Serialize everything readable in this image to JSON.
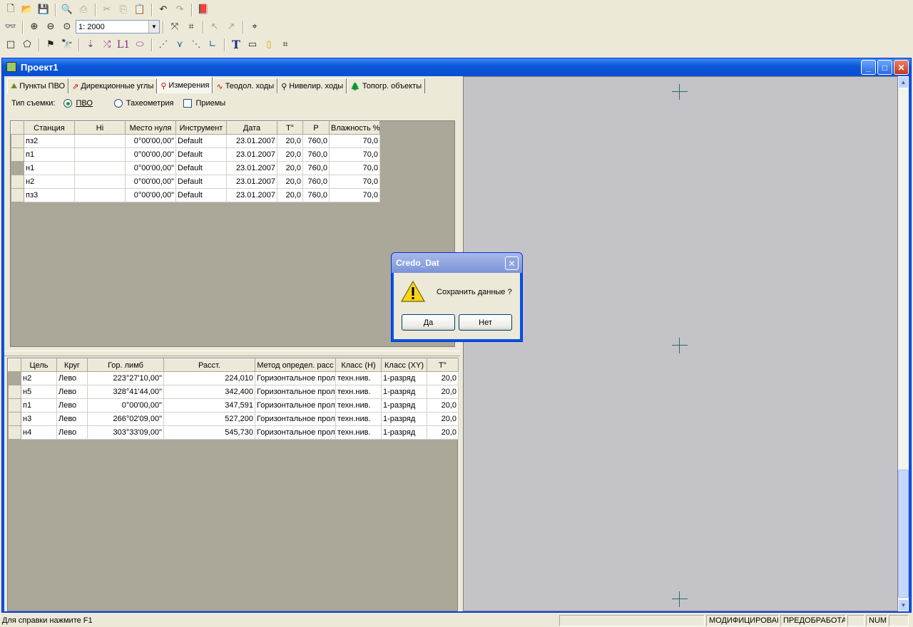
{
  "toolbar1": {
    "icons": [
      "new-file-icon",
      "open-folder-icon",
      "save-icon",
      "print-preview-icon",
      "print-icon",
      "cut-icon",
      "copy-icon",
      "paste-icon",
      "undo-icon",
      "redo-icon",
      "book-icon"
    ]
  },
  "toolbar2": {
    "scale_value": "1: 2000"
  },
  "toolbar3": {
    "text_tool": "T",
    "line_tool": "L1"
  },
  "window": {
    "title": "Проект1"
  },
  "tabs": [
    {
      "label": "Пункты ПВО",
      "icon": "points-icon"
    },
    {
      "label": "Дирекционные углы",
      "icon": "angle-icon"
    },
    {
      "label": "Измерения",
      "icon": "tripod-icon"
    },
    {
      "label": "Теодол. ходы",
      "icon": "traverse-icon"
    },
    {
      "label": "Нивелир. ходы",
      "icon": "level-icon"
    },
    {
      "label": "Топогр. объекты",
      "icon": "tree-icon"
    }
  ],
  "survey": {
    "label": "Тип съемки:",
    "opt1": "ПВО",
    "opt2": "Тахеометрия",
    "chk": "Приемы"
  },
  "stations": {
    "headers": [
      "Станция",
      "Hi",
      "Место нуля",
      "Инструмент",
      "Дата",
      "T°",
      "P",
      "Влажность %"
    ],
    "rows": [
      [
        "пз2",
        "",
        "0°00'00,00\"",
        "Default",
        "23.01.2007",
        "20,0",
        "760,0",
        "70,0"
      ],
      [
        "п1",
        "",
        "0°00'00,00\"",
        "Default",
        "23.01.2007",
        "20,0",
        "760,0",
        "70,0"
      ],
      [
        "н1",
        "",
        "0°00'00,00\"",
        "Default",
        "23.01.2007",
        "20,0",
        "760,0",
        "70,0"
      ],
      [
        "н2",
        "",
        "0°00'00,00\"",
        "Default",
        "23.01.2007",
        "20,0",
        "760,0",
        "70,0"
      ],
      [
        "пз3",
        "",
        "0°00'00,00\"",
        "Default",
        "23.01.2007",
        "20,0",
        "760,0",
        "70,0"
      ]
    ]
  },
  "targets": {
    "headers": [
      "Цель",
      "Круг",
      "Гор. лимб",
      "Расст.",
      "Метод определ. расс",
      "Класс (H)",
      "Класс (XY)",
      "T°"
    ],
    "rows": [
      [
        "н2",
        "Лево",
        "223°27'10,00\"",
        "224,010",
        "Горизонтальное прол",
        "техн.нив.",
        "1-разряд",
        "20,0"
      ],
      [
        "н5",
        "Лево",
        "328°41'44,00\"",
        "342,400",
        "Горизонтальное прол",
        "техн.нив.",
        "1-разряд",
        "20,0"
      ],
      [
        "п1",
        "Лево",
        "0°00'00,00\"",
        "347,591",
        "Горизонтальное прол",
        "техн.нив.",
        "1-разряд",
        "20,0"
      ],
      [
        "н3",
        "Лево",
        "266°02'09,00\"",
        "527,200",
        "Горизонтальное прол",
        "техн.нив.",
        "1-разряд",
        "20,0"
      ],
      [
        "н4",
        "Лево",
        "303°33'09,00\"",
        "545,730",
        "Горизонтальное прол",
        "техн.нив.",
        "1-разряд",
        "20,0"
      ]
    ]
  },
  "dialog": {
    "title": "Credo_Dat",
    "message": "Сохранить данные ?",
    "yes": "Да",
    "no": "Нет"
  },
  "status": {
    "help": "Для справки нажмите F1",
    "s1": "",
    "s2": "МОДИФИЦИРОВАН",
    "s3": "ПРЕДОБРАБОТАН",
    "s4": "",
    "s5": "NUM",
    "s6": ""
  }
}
